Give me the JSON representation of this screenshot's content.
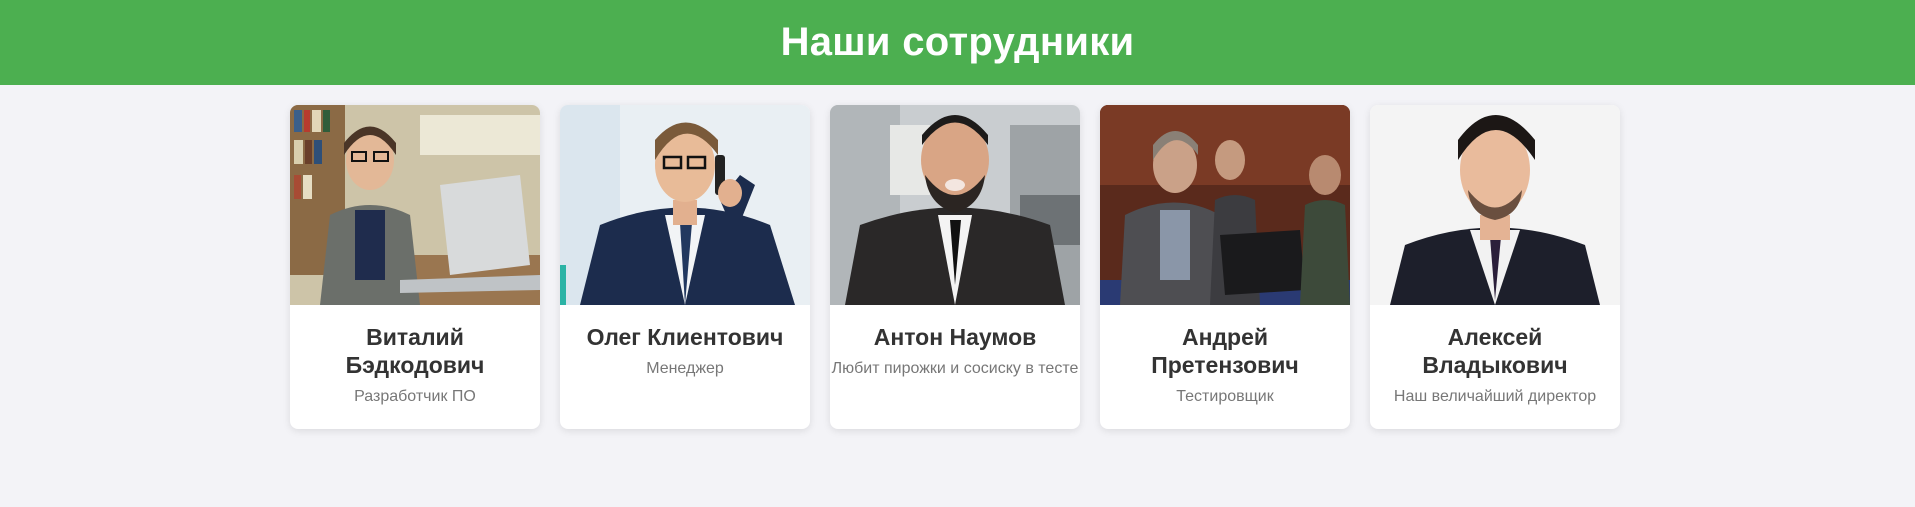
{
  "header": {
    "title": "Наши сотрудники"
  },
  "colors": {
    "header_bg": "#4caf50",
    "page_bg": "#f3f3f7",
    "card_bg": "#ffffff"
  },
  "employees": [
    {
      "name": "Виталий Бэдкодович",
      "role": "Разработчик ПО",
      "photo_icon": "developer-photo"
    },
    {
      "name": "Олег Клиентович",
      "role": "Менеджер",
      "photo_icon": "manager-photo"
    },
    {
      "name": "Антон Наумов",
      "role": "Любит пирожки и сосиску в тесте",
      "photo_icon": "employee-photo"
    },
    {
      "name": "Андрей Претензович",
      "role": "Тестировщик",
      "photo_icon": "tester-photo"
    },
    {
      "name": "Алексей Владыкович",
      "role": "Наш величайший директор",
      "photo_icon": "director-photo"
    }
  ]
}
